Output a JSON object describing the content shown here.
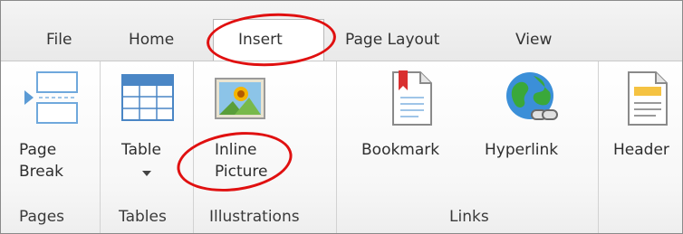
{
  "tabs": [
    "File",
    "Home",
    "Insert",
    "Page Layout",
    "View"
  ],
  "active_tab": "Insert",
  "groups": {
    "pages": {
      "label": "Pages",
      "buttons": [
        {
          "line1": "Page",
          "line2": "Break",
          "icon": "page-break-icon"
        }
      ]
    },
    "tables": {
      "label": "Tables",
      "buttons": [
        {
          "line1": "Table",
          "icon": "table-icon",
          "has_dropdown": true
        }
      ]
    },
    "illustrations": {
      "label": "Illustrations",
      "buttons": [
        {
          "line1": "Inline",
          "line2": "Picture",
          "icon": "picture-icon"
        }
      ]
    },
    "links": {
      "label": "Links",
      "buttons": [
        {
          "line1": "Bookmark",
          "icon": "bookmark-icon"
        },
        {
          "line1": "Hyperlink",
          "icon": "hyperlink-icon"
        }
      ]
    },
    "header_footer": {
      "buttons": [
        {
          "line1": "Header",
          "icon": "header-icon"
        }
      ]
    }
  },
  "colors": {
    "annotation": "#e01010",
    "tab_bar": "#efefef",
    "group_separator": "#d2d2d2"
  }
}
